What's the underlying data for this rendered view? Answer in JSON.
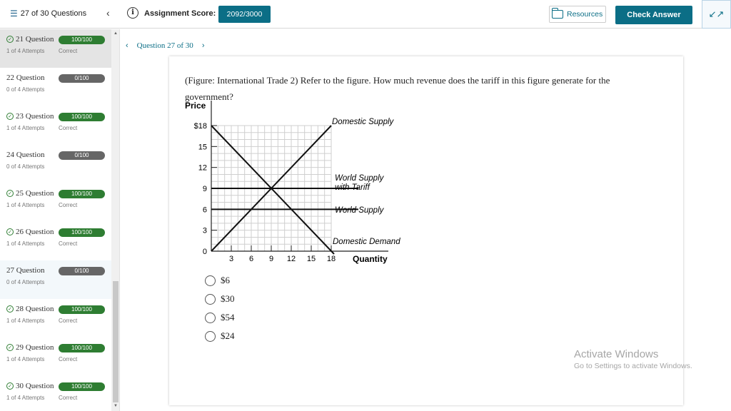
{
  "topbar": {
    "question_count": "27 of 30 Questions",
    "score_label": "Assignment Score:",
    "score_value": "2092/3000",
    "resources_label": "Resources",
    "check_answer_label": "Check Answer"
  },
  "sidebar": {
    "items": [
      {
        "title": "21 Question",
        "score": "100/100",
        "attempts": "1 of 4 Attempts",
        "status": "Correct",
        "correct": true
      },
      {
        "title": "22 Question",
        "score": "0/100",
        "attempts": "0 of 4 Attempts",
        "status": "",
        "correct": false
      },
      {
        "title": "23 Question",
        "score": "100/100",
        "attempts": "1 of 4 Attempts",
        "status": "Correct",
        "correct": true
      },
      {
        "title": "24 Question",
        "score": "0/100",
        "attempts": "0 of 4 Attempts",
        "status": "",
        "correct": false
      },
      {
        "title": "25 Question",
        "score": "100/100",
        "attempts": "1 of 4 Attempts",
        "status": "Correct",
        "correct": true
      },
      {
        "title": "26 Question",
        "score": "100/100",
        "attempts": "1 of 4 Attempts",
        "status": "Correct",
        "correct": true
      },
      {
        "title": "27 Question",
        "score": "0/100",
        "attempts": "0 of 4 Attempts",
        "status": "",
        "correct": false
      },
      {
        "title": "28 Question",
        "score": "100/100",
        "attempts": "1 of 4 Attempts",
        "status": "Correct",
        "correct": true
      },
      {
        "title": "29 Question",
        "score": "100/100",
        "attempts": "1 of 4 Attempts",
        "status": "Correct",
        "correct": true
      },
      {
        "title": "30 Question",
        "score": "100/100",
        "attempts": "1 of 4 Attempts",
        "status": "Correct",
        "correct": true
      }
    ]
  },
  "breadcrumb": {
    "label": "Question 27 of 30"
  },
  "question": {
    "text": "(Figure: International Trade 2) Refer to the figure. How much revenue does the tariff in this figure generate for the government?"
  },
  "figure": {
    "y_axis_label": "Price",
    "x_axis_label": "Quantity",
    "y_ticks": [
      "$18",
      "15",
      "12",
      "9",
      "6",
      "3",
      "0"
    ],
    "x_ticks": [
      "3",
      "6",
      "9",
      "12",
      "15",
      "18"
    ],
    "labels": {
      "domestic_supply": "Domestic Supply",
      "world_supply_tariff_1": "World Supply",
      "world_supply_tariff_2": "with Tariff",
      "world_supply": "World Supply",
      "domestic_demand": "Domestic Demand"
    },
    "lines": {
      "domestic_supply": [
        [
          0,
          0
        ],
        [
          18,
          18
        ]
      ],
      "domestic_demand": [
        [
          0,
          18
        ],
        [
          18,
          0
        ]
      ],
      "world_supply_tariff": 9,
      "world_supply": 6
    }
  },
  "options": [
    "$6",
    "$30",
    "$54",
    "$24"
  ],
  "watermark": {
    "title": "Activate Windows",
    "subtitle": "Go to Settings to activate Windows."
  },
  "colors": {
    "accent": "#0b6e86",
    "correct": "#2e7d32",
    "incorrect_badge": "#666666"
  }
}
